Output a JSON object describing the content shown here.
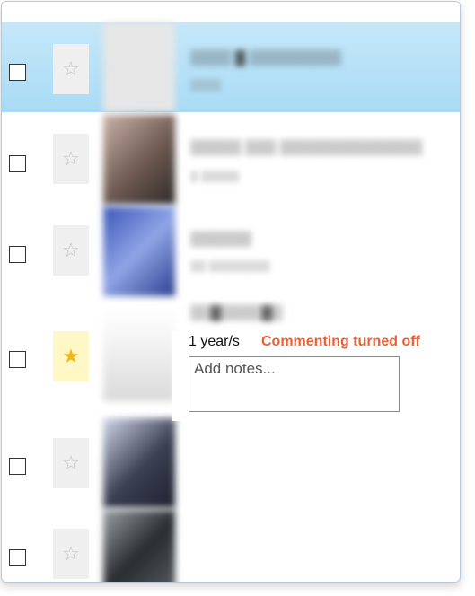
{
  "notes_panel": {
    "age": "1 year/s",
    "status": "Commenting turned off",
    "notes_placeholder": "Add notes..."
  },
  "rows": [
    {
      "selected": true,
      "favorite": false
    },
    {
      "selected": false,
      "favorite": false
    },
    {
      "selected": false,
      "favorite": false
    },
    {
      "selected": false,
      "favorite": true
    },
    {
      "selected": false,
      "favorite": false
    },
    {
      "selected": false,
      "favorite": false
    }
  ],
  "icons": {
    "checkbox": "checkbox-icon",
    "star_empty": "star-outline-icon",
    "star_filled": "star-filled-icon"
  },
  "colors": {
    "selected_row": "#b7e0f7",
    "favorite_star": "#f1b71e",
    "favorite_bg": "#fff8c6",
    "status_warning": "#f05d32"
  }
}
